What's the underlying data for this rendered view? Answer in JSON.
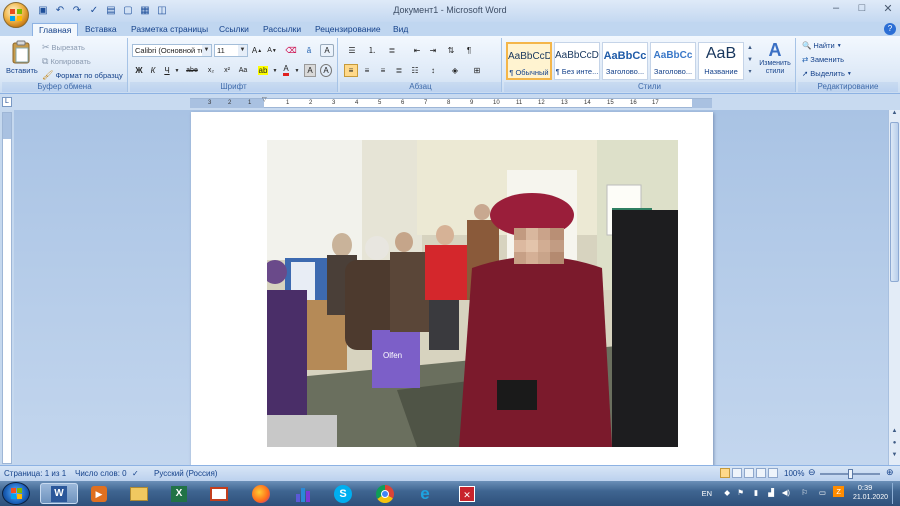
{
  "window": {
    "title": "Документ1 - Microsoft Word",
    "controls": [
      "minimize-icon",
      "maximize-icon",
      "close-icon"
    ]
  },
  "quick_access": [
    "save-icon",
    "undo-icon",
    "redo-icon",
    "spelling-icon",
    "open-icon",
    "new-icon",
    "print-icon",
    "print-preview-icon"
  ],
  "tabs": [
    {
      "label": "Главная",
      "active": true
    },
    {
      "label": "Вставка"
    },
    {
      "label": "Разметка страницы"
    },
    {
      "label": "Ссылки"
    },
    {
      "label": "Рассылки"
    },
    {
      "label": "Рецензирование"
    },
    {
      "label": "Вид"
    }
  ],
  "ribbon": {
    "clipboard": {
      "label": "Буфер обмена",
      "paste": "Вставить",
      "cut": "Вырезать",
      "copy": "Копировать",
      "format_painter": "Формат по образцу"
    },
    "font": {
      "label": "Шрифт",
      "font_name": "Calibri (Основной текст)",
      "font_size": "11",
      "bold": "Ж",
      "italic": "К",
      "underline": "Ч",
      "strike": "abe",
      "subscript": "x₂",
      "superscript": "x²",
      "change_case": "Aa",
      "grow": "A",
      "shrink": "A",
      "clear": "A",
      "text_effects": "A"
    },
    "paragraph": {
      "label": "Абзац",
      "show_marks": "¶"
    },
    "styles": {
      "label": "Стили",
      "items": [
        {
          "preview": "AaBbCcDc",
          "name": "¶ Обычный",
          "selected": true
        },
        {
          "preview": "AaBbCcDc",
          "name": "¶ Без инте..."
        },
        {
          "preview": "AaBbCc",
          "name": "Заголово..."
        },
        {
          "preview": "AaBbCc",
          "name": "Заголово..."
        },
        {
          "preview": "AaB",
          "name": "Название"
        }
      ],
      "change_styles": "Изменить стили"
    },
    "editing": {
      "label": "Редактирование",
      "find": "Найти",
      "replace": "Заменить",
      "select": "Выделить"
    }
  },
  "ruler": {
    "numbers": [
      "3",
      "2",
      "1",
      "1",
      "2",
      "3",
      "4",
      "5",
      "6",
      "7",
      "8",
      "9",
      "10",
      "11",
      "12",
      "13",
      "14",
      "15",
      "16",
      "17"
    ]
  },
  "statusbar": {
    "page": "Страница: 1 из 1",
    "words": "Число слов: 0",
    "language": "Русский (Россия)",
    "zoom": "100%"
  },
  "taskbar": {
    "language": "EN",
    "time": "0:39",
    "date": "21.01.2020",
    "apps": [
      "word-icon",
      "media-player-icon",
      "file-explorer-icon",
      "excel-icon",
      "presentation-icon",
      "firefox-icon",
      "bar-chart-app-icon",
      "skype-icon",
      "chrome-icon",
      "internet-explorer-icon",
      "red-app-icon"
    ]
  },
  "colors": {
    "ribbon_text": "#15428b",
    "highlight_yellow": "#f4b64a",
    "font_color_red": "#e02020"
  }
}
